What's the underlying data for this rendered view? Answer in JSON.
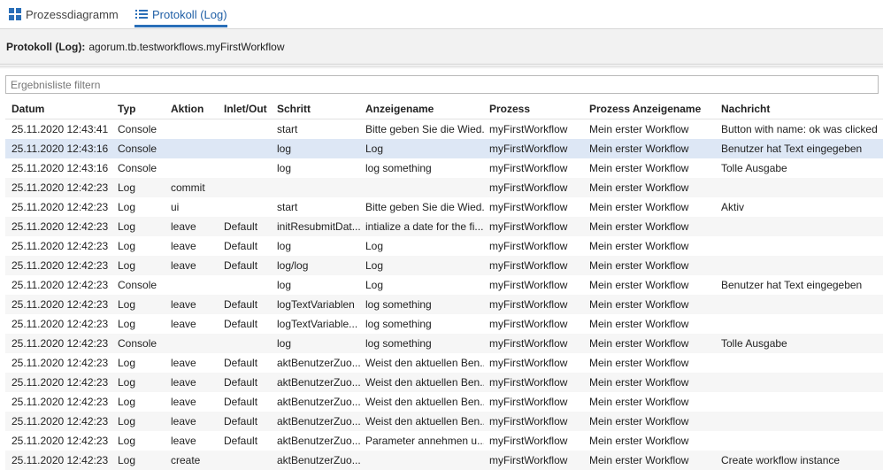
{
  "tabs": [
    {
      "label": "Prozessdiagramm",
      "icon": "process-diagram-icon"
    },
    {
      "label": "Protokoll (Log)",
      "icon": "list-icon",
      "active": true
    }
  ],
  "header": {
    "label": "Protokoll (Log):",
    "value": "agorum.tb.testworkflows.myFirstWorkflow"
  },
  "filter": {
    "placeholder": "Ergebnisliste filtern"
  },
  "columns": [
    "Datum",
    "Typ",
    "Aktion",
    "Inlet/Out",
    "Schritt",
    "Anzeigename",
    "Prozess",
    "Prozess Anzeigename",
    "Nachricht"
  ],
  "rows": [
    [
      "25.11.2020 12:43:41",
      "Console",
      "",
      "",
      "start",
      "Bitte geben Sie die Wied...",
      "myFirstWorkflow",
      "Mein erster Workflow",
      "Button with name: ok was clicked"
    ],
    [
      "25.11.2020 12:43:16",
      "Console",
      "",
      "",
      "log",
      "Log",
      "myFirstWorkflow",
      "Mein erster Workflow",
      "Benutzer hat Text eingegeben"
    ],
    [
      "25.11.2020 12:43:16",
      "Console",
      "",
      "",
      "log",
      "log something",
      "myFirstWorkflow",
      "Mein erster Workflow",
      "Tolle Ausgabe"
    ],
    [
      "25.11.2020 12:42:23",
      "Log",
      "commit",
      "",
      "",
      "",
      "myFirstWorkflow",
      "Mein erster Workflow",
      ""
    ],
    [
      "25.11.2020 12:42:23",
      "Log",
      "ui",
      "",
      "start",
      "Bitte geben Sie die Wied...",
      "myFirstWorkflow",
      "Mein erster Workflow",
      "Aktiv"
    ],
    [
      "25.11.2020 12:42:23",
      "Log",
      "leave",
      "Default",
      "initResubmitDat...",
      "intialize a date for the fi...",
      "myFirstWorkflow",
      "Mein erster Workflow",
      ""
    ],
    [
      "25.11.2020 12:42:23",
      "Log",
      "leave",
      "Default",
      "log",
      "Log",
      "myFirstWorkflow",
      "Mein erster Workflow",
      ""
    ],
    [
      "25.11.2020 12:42:23",
      "Log",
      "leave",
      "Default",
      "log/log",
      "Log",
      "myFirstWorkflow",
      "Mein erster Workflow",
      ""
    ],
    [
      "25.11.2020 12:42:23",
      "Console",
      "",
      "",
      "log",
      "Log",
      "myFirstWorkflow",
      "Mein erster Workflow",
      "Benutzer hat Text eingegeben"
    ],
    [
      "25.11.2020 12:42:23",
      "Log",
      "leave",
      "Default",
      "logTextVariablen",
      "log something",
      "myFirstWorkflow",
      "Mein erster Workflow",
      ""
    ],
    [
      "25.11.2020 12:42:23",
      "Log",
      "leave",
      "Default",
      "logTextVariable...",
      "log something",
      "myFirstWorkflow",
      "Mein erster Workflow",
      ""
    ],
    [
      "25.11.2020 12:42:23",
      "Console",
      "",
      "",
      "log",
      "log something",
      "myFirstWorkflow",
      "Mein erster Workflow",
      "Tolle Ausgabe"
    ],
    [
      "25.11.2020 12:42:23",
      "Log",
      "leave",
      "Default",
      "aktBenutzerZuo...",
      "Weist den aktuellen Ben...",
      "myFirstWorkflow",
      "Mein erster Workflow",
      ""
    ],
    [
      "25.11.2020 12:42:23",
      "Log",
      "leave",
      "Default",
      "aktBenutzerZuo...",
      "Weist den aktuellen Ben...",
      "myFirstWorkflow",
      "Mein erster Workflow",
      ""
    ],
    [
      "25.11.2020 12:42:23",
      "Log",
      "leave",
      "Default",
      "aktBenutzerZuo...",
      "Weist den aktuellen Ben...",
      "myFirstWorkflow",
      "Mein erster Workflow",
      ""
    ],
    [
      "25.11.2020 12:42:23",
      "Log",
      "leave",
      "Default",
      "aktBenutzerZuo...",
      "Weist den aktuellen Ben...",
      "myFirstWorkflow",
      "Mein erster Workflow",
      ""
    ],
    [
      "25.11.2020 12:42:23",
      "Log",
      "leave",
      "Default",
      "aktBenutzerZuo...",
      "Parameter annehmen u...",
      "myFirstWorkflow",
      "Mein erster Workflow",
      ""
    ],
    [
      "25.11.2020 12:42:23",
      "Log",
      "create",
      "",
      "aktBenutzerZuo...",
      "",
      "myFirstWorkflow",
      "Mein erster Workflow",
      "Create workflow instance"
    ]
  ],
  "selected_row": 1
}
